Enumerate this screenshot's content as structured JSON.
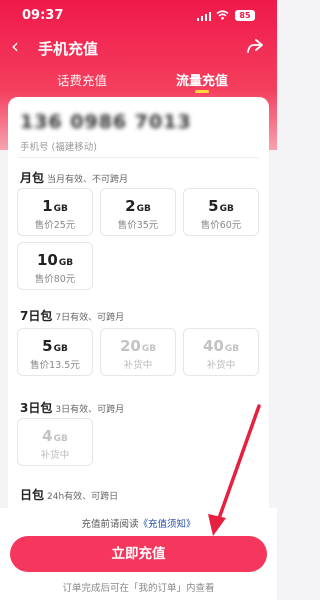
{
  "status": {
    "time": "09:37",
    "battery": "85"
  },
  "nav": {
    "title": "手机充值"
  },
  "tabs": {
    "phone_credit": "话费充值",
    "data_topup": "流量充值"
  },
  "account": {
    "phone_number": "136 0986 7013",
    "carrier": "手机号 (福建移动)"
  },
  "sections": {
    "monthly": {
      "title": "月包",
      "desc": "当月有效、不可跨月"
    },
    "seven_day": {
      "title": "7日包",
      "desc": "7日有效、可跨月"
    },
    "three_day": {
      "title": "3日包",
      "desc": "3日有效、可跨月"
    },
    "daily": {
      "title": "日包",
      "desc": "24h有效、可跨日"
    }
  },
  "packages": {
    "m1": {
      "amount": "1",
      "unit": "GB",
      "price": "售价25元"
    },
    "m2": {
      "amount": "2",
      "unit": "GB",
      "price": "售价35元"
    },
    "m3": {
      "amount": "5",
      "unit": "GB",
      "price": "售价60元"
    },
    "m4": {
      "amount": "10",
      "unit": "GB",
      "price": "售价80元"
    },
    "s1": {
      "amount": "5",
      "unit": "GB",
      "price": "售价13.5元"
    },
    "s2": {
      "amount": "20",
      "unit": "GB",
      "price": "补货中"
    },
    "s3": {
      "amount": "40",
      "unit": "GB",
      "price": "补货中"
    },
    "t1": {
      "amount": "4",
      "unit": "GB",
      "price": "补货中"
    }
  },
  "footer": {
    "notice_prefix": "充值前请阅读",
    "notice_link": "《充值须知》",
    "button": "立即充值",
    "hint": "订单完成后可在「我的订单」内查看"
  },
  "colors": {
    "brand": "#f0194a",
    "button": "#f5375d",
    "link": "#1f4ea8",
    "tab_indicator": "#ffd83d",
    "annotation_arrow": "#e8203f"
  }
}
